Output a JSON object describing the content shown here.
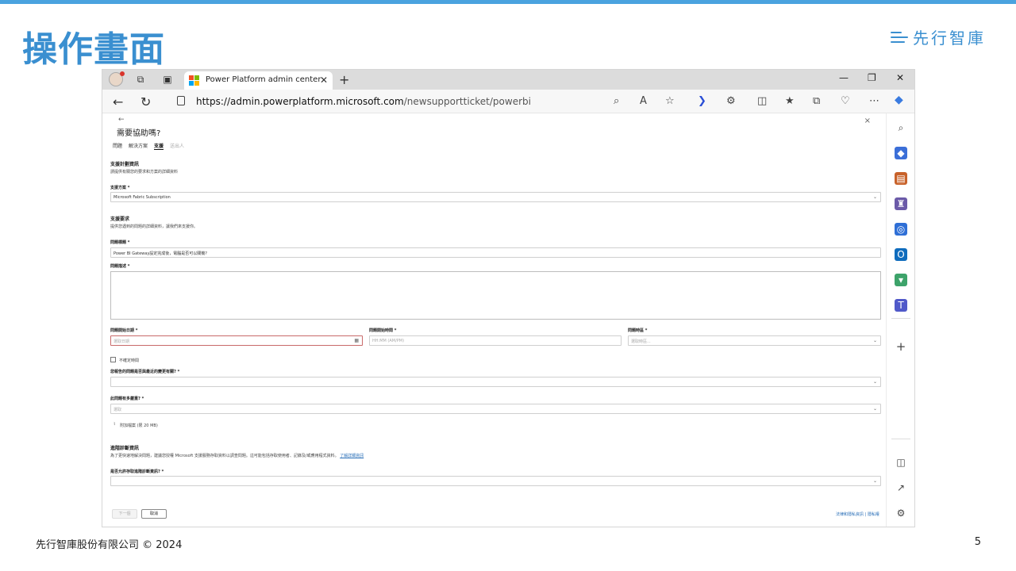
{
  "slide": {
    "title": "操作畫面",
    "brand": "先行智庫",
    "footer": "先行智庫股份有限公司 © 2024",
    "page_number": "5",
    "accent": "#3a8fd0"
  },
  "browser": {
    "tab_title": "Power Platform admin center",
    "url_host": "https://admin.powerplatform.microsoft.com",
    "url_path": "/newsupportticket/powerbi",
    "icons": {
      "back": "arrow-left-icon",
      "refresh": "refresh-icon",
      "close_tab": "close-icon",
      "new_tab": "plus-icon"
    }
  },
  "panel": {
    "back": "←",
    "close": "×",
    "title": "需要協助嗎?",
    "steps": [
      "問題",
      "解決方案",
      "支援",
      "送出人"
    ],
    "plan_heading": "支援計劃資訊",
    "plan_desc": "請提供有關您的要求和方案的詳細資料",
    "plan_label": "支援方案 *",
    "plan_value": "Microsoft Fabric Subscription",
    "req_heading": "支援要求",
    "req_desc": "提供您遇到的問題的詳細資料，讓我們來支援你。",
    "issue_title_label": "問題標題 *",
    "issue_title_value": "Power BI Gateway設定完成後，電腦是否可以關機?",
    "issue_desc_label": "問題描述 *",
    "start_date_label": "問題開始日期 *",
    "start_date_placeholder": "選取日期",
    "start_time_label": "問題開始時間 *",
    "start_time_placeholder": "HH:MM (AM/PM)",
    "timezone_label": "問題時區 *",
    "timezone_placeholder": "選取時區...",
    "unknown_time_label": "不確定時間",
    "recent_change_label": "您報告的問題是否與最近的變更有關? *",
    "severity_label": "此問題有多嚴重? *",
    "severity_placeholder": "選取",
    "attach_label": "附加檔案 (限 20 MB)",
    "diag_heading": "進階診斷資訊",
    "diag_desc": "為了更快速地解決問題，建議您授權 Microsoft 支援服務存取資料以調查問題。這可能包括存取使用者、記錄及/或應用程式資料。",
    "diag_link": "了解詳細資訊",
    "diag_allow_label": "是否允許存取進階診斷資訊? *",
    "btn_next": "下一個",
    "btn_cancel": "取消",
    "legal_link": "法律和隱私資訊 | 隱私權"
  }
}
